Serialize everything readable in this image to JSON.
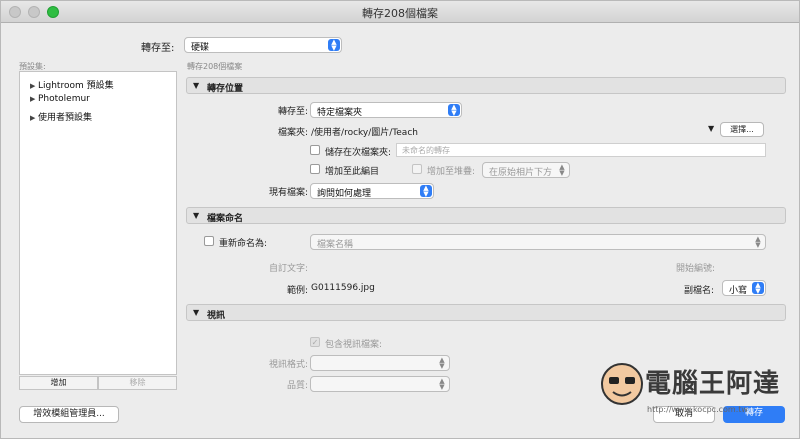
{
  "window": {
    "title": "轉存208個檔案"
  },
  "destination": {
    "label": "轉存至:",
    "value": "硬碟"
  },
  "presets": {
    "label": "預設集:",
    "items": [
      {
        "label": "Lightroom 預設集"
      },
      {
        "label": "Photolemur"
      },
      {
        "label": "使用者預設集"
      }
    ],
    "add_label": "增加",
    "remove_label": "移除"
  },
  "export_count": "轉存208個檔案",
  "location": {
    "title": "轉存位置",
    "export_to_label": "轉存至:",
    "export_to_value": "特定檔案夾",
    "folder_label": "檔案夾:",
    "folder_path": "/使用者/rocky/圖片/Teach",
    "choose_label": "選擇...",
    "subfolder_label": "儲存在次檔案夾:",
    "subfolder_placeholder": "未命名的轉存",
    "add_to_catalog_label": "增加至此編目",
    "add_to_stack_label": "增加至堆疊:",
    "stack_position": "在原始相片下方",
    "existing_files_label": "現有檔案:",
    "existing_files_value": "詢問如何處理"
  },
  "naming": {
    "title": "檔案命名",
    "rename_label": "重新命名為:",
    "rename_value": "檔案名稱",
    "custom_text_label": "自訂文字:",
    "start_number_label": "開始編號:",
    "example_label": "範例:",
    "example_value": "G0111596.jpg",
    "extension_label": "副檔名:",
    "extension_value": "小寫"
  },
  "video": {
    "title": "視訊",
    "include_video_label": "包含視訊檔案:",
    "video_format_label": "視訊格式:",
    "quality_label": "品質:"
  },
  "footer": {
    "plugin_manager_label": "增效模組管理員...",
    "cancel_label": "取消",
    "export_label": "轉存"
  },
  "watermark": {
    "text": "電腦王阿達",
    "url": "http://www.kocpc.com.tw"
  },
  "colors": {
    "accent": "#2f7df6",
    "close": "#c8c8c8",
    "maximize": "#2fbd42"
  }
}
